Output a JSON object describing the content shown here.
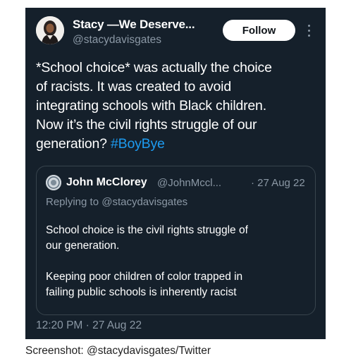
{
  "tweet": {
    "author_name": "Stacy —We Deserve...",
    "author_handle": "@stacydavisgates",
    "follow_label": "Follow",
    "text_lines": [
      "*School choice* was actually the choice",
      "of racists. It was created to avoid",
      "integrating schools with Black children.",
      "Now it’s the civil rights struggle of our"
    ],
    "last_line_prefix": "generation? ",
    "hashtag": "#BoyBye",
    "timestamp": "12:20 PM · 27 Aug 22"
  },
  "quoted_tweet": {
    "author_name": "John McClorey",
    "author_handle": "@JohnMccl...",
    "date": "· 27 Aug 22",
    "replying_to": "Replying to @stacydavisgates",
    "para1_lines": [
      "School choice is the civil rights struggle of",
      "our generation."
    ],
    "para2_lines": [
      "Keeping poor children of color trapped in",
      "failing public schools is inherently racist"
    ]
  },
  "caption": "Screenshot: @stacydavisgates/Twitter",
  "colors": {
    "card_background": "#15202b",
    "secondary_text": "#8b98a5",
    "link_blue": "#1d9bf0",
    "border": "#38444d"
  },
  "icons": {
    "more": "more-options-icon"
  }
}
